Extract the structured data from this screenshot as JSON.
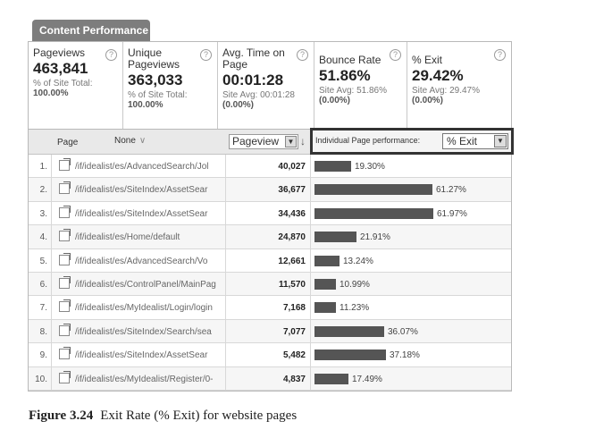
{
  "tab": {
    "label": "Content Performance"
  },
  "metrics": [
    {
      "title": "Pageviews",
      "value": "463,841",
      "sub1": "% of Site Total:",
      "sub2": "100.00%"
    },
    {
      "title": "Unique Pageviews",
      "value": "363,033",
      "sub1": "% of Site Total:",
      "sub2": "100.00%"
    },
    {
      "title": "Avg. Time on Page",
      "value": "00:01:28",
      "sub1": "Site Avg: 00:01:28",
      "sub2": "(0.00%)"
    },
    {
      "title": "Bounce Rate",
      "value": "51.86%",
      "sub1": "Site Avg: 51.86%",
      "sub2": "(0.00%)"
    },
    {
      "title": "% Exit",
      "value": "29.42%",
      "sub1": "Site Avg: 29.47%",
      "sub2": "(0.00%)"
    }
  ],
  "table": {
    "header": {
      "page": "Page",
      "segment": "None",
      "pageviews_select": "Pageview",
      "perf_label": "Individual Page performance:",
      "exit_select": "% Exit"
    },
    "rows": [
      {
        "n": "1.",
        "path": "/if/idealist/es/AdvancedSearch/Jol",
        "pageviews": "40,027",
        "exit": 19.3,
        "exit_label": "19.30%"
      },
      {
        "n": "2.",
        "path": "/if/idealist/es/SiteIndex/AssetSear",
        "pageviews": "36,677",
        "exit": 61.27,
        "exit_label": "61.27%"
      },
      {
        "n": "3.",
        "path": "/if/idealist/es/SiteIndex/AssetSear",
        "pageviews": "34,436",
        "exit": 61.97,
        "exit_label": "61.97%"
      },
      {
        "n": "4.",
        "path": "/if/idealist/es/Home/default",
        "pageviews": "24,870",
        "exit": 21.91,
        "exit_label": "21.91%"
      },
      {
        "n": "5.",
        "path": "/if/idealist/es/AdvancedSearch/Vo",
        "pageviews": "12,661",
        "exit": 13.24,
        "exit_label": "13.24%"
      },
      {
        "n": "6.",
        "path": "/if/idealist/es/ControlPanel/MainPag",
        "pageviews": "11,570",
        "exit": 10.99,
        "exit_label": "10.99%"
      },
      {
        "n": "7.",
        "path": "/if/idealist/es/MyIdealist/Login/login",
        "pageviews": "7,168",
        "exit": 11.23,
        "exit_label": "11.23%"
      },
      {
        "n": "8.",
        "path": "/if/idealist/es/SiteIndex/Search/sea",
        "pageviews": "7,077",
        "exit": 36.07,
        "exit_label": "36.07%"
      },
      {
        "n": "9.",
        "path": "/if/idealist/es/SiteIndex/AssetSear",
        "pageviews": "5,482",
        "exit": 37.18,
        "exit_label": "37.18%"
      },
      {
        "n": "10.",
        "path": "/if/idealist/es/MyIdealist/Register/0-",
        "pageviews": "4,837",
        "exit": 17.49,
        "exit_label": "17.49%"
      }
    ]
  },
  "caption": {
    "figure": "Figure 3.24",
    "text": "Exit Rate (% Exit) for website pages"
  },
  "colors": {
    "bar": "#555555",
    "tab": "#7d7d7d",
    "header_bg": "#e9e9e9"
  }
}
